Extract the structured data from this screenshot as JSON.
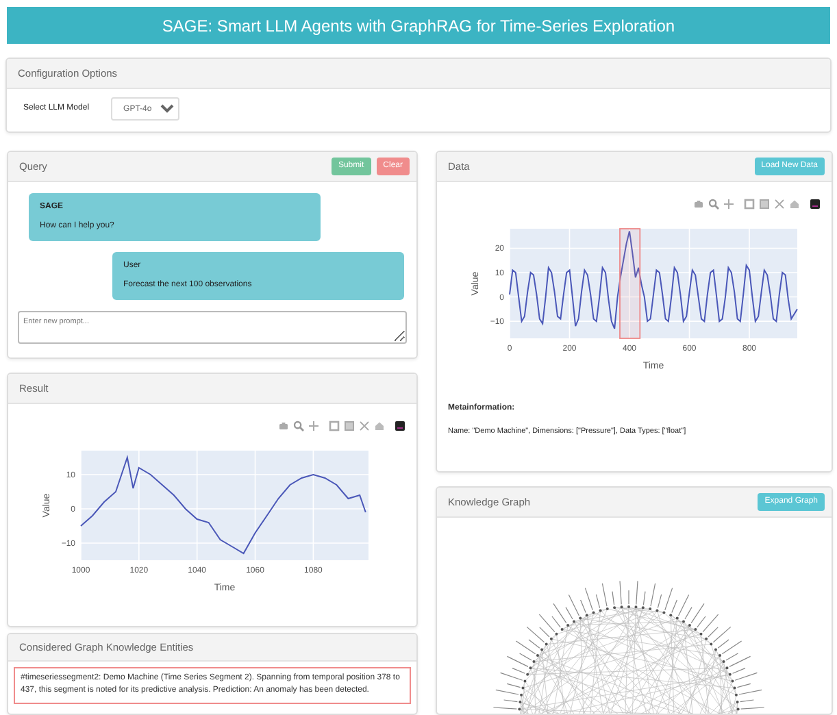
{
  "header": {
    "title": "SAGE: Smart LLM Agents with GraphRAG for Time-Series Exploration"
  },
  "config": {
    "title": "Configuration Options",
    "model_label": "Select LLM Model",
    "model": "GPT-4o"
  },
  "query": {
    "title": "Query",
    "buttons": [
      {
        "label": "Submit",
        "kind": "success"
      },
      {
        "label": "Clear",
        "kind": "danger"
      }
    ],
    "messages": [
      {
        "kind": "agent",
        "sender": "SAGE",
        "text": "How can I help you?"
      },
      {
        "kind": "user",
        "sender": "User",
        "text": "Forecast the next 100 observations"
      }
    ],
    "prompt": {
      "placeholder": "Enter new prompt..."
    }
  },
  "result": {
    "title": "Result",
    "chart_data": {
      "type": "line",
      "xlabel": "Time",
      "ylabel": "Value",
      "x": [
        1000,
        1004,
        1008,
        1012,
        1016,
        1018,
        1020,
        1024,
        1028,
        1032,
        1036,
        1040,
        1044,
        1048,
        1052,
        1056,
        1060,
        1064,
        1068,
        1072,
        1076,
        1080,
        1084,
        1088,
        1092,
        1096,
        1098
      ],
      "series": [
        {
          "color": "#4a57b8",
          "values": [
            -5,
            -2,
            2,
            5,
            15,
            6,
            12,
            10,
            7,
            4,
            0,
            -3,
            -4,
            -9,
            -11,
            -13,
            -7,
            -2,
            3,
            7,
            9,
            10,
            9,
            7,
            3,
            4,
            -1
          ]
        }
      ],
      "xlim": [
        1000,
        1099
      ],
      "ylim": [
        -15,
        17
      ],
      "grid": true,
      "xticks": [
        1000,
        1020,
        1040,
        1060,
        1080
      ],
      "yticks": [
        10,
        0,
        {
          "value": -10,
          "label": "−10"
        }
      ]
    }
  },
  "entities": {
    "title": "Considered Graph Knowledge Entities",
    "items": [
      "#timeseriessegment2: Demo Machine (Time Series Segment 2). Spanning from temporal position 378 to 437, this segment is noted for its predictive analysis. Prediction: An anomaly has been detected."
    ]
  },
  "data": {
    "title": "Data",
    "button": "Load New Data",
    "chart_data": {
      "type": "line",
      "xlabel": "Time",
      "ylabel": "Value",
      "x": [
        0,
        10,
        20,
        30,
        40,
        50,
        60,
        70,
        80,
        90,
        100,
        110,
        120,
        130,
        140,
        150,
        160,
        170,
        180,
        190,
        200,
        210,
        220,
        230,
        240,
        250,
        260,
        270,
        280,
        290,
        300,
        310,
        320,
        330,
        340,
        350,
        360,
        370,
        380,
        390,
        400,
        410,
        420,
        430,
        440,
        450,
        460,
        470,
        480,
        490,
        500,
        510,
        520,
        530,
        540,
        550,
        560,
        570,
        580,
        590,
        600,
        610,
        620,
        630,
        640,
        650,
        660,
        670,
        680,
        690,
        700,
        710,
        720,
        730,
        740,
        750,
        760,
        770,
        780,
        790,
        800,
        810,
        820,
        830,
        840,
        850,
        860,
        870,
        880,
        890,
        900,
        910,
        920,
        930,
        940,
        950,
        960
      ],
      "series": [
        {
          "color": "#4a57b8",
          "values": [
            1,
            11,
            10,
            0,
            -10,
            -8,
            2,
            10,
            9,
            1,
            -9,
            -11,
            0,
            12,
            10,
            2,
            -8,
            -9,
            1,
            10,
            11,
            0,
            -12,
            -9,
            2,
            11,
            9,
            1,
            -9,
            -10,
            0,
            12,
            10,
            -1,
            -10,
            -13,
            0,
            8,
            15,
            22,
            27,
            18,
            8,
            12,
            5,
            0,
            -10,
            -9,
            1,
            11,
            10,
            1,
            -9,
            -10,
            0,
            12,
            10,
            1,
            -10,
            -8,
            2,
            11,
            9,
            0,
            -9,
            -10,
            1,
            10,
            11,
            1,
            -10,
            -9,
            0,
            12,
            10,
            2,
            -9,
            -10,
            1,
            13,
            11,
            0,
            -10,
            -8,
            2,
            11,
            9,
            1,
            -9,
            -10,
            1,
            10,
            9,
            -1,
            -9,
            -7,
            -5
          ]
        }
      ],
      "xlim": [
        0,
        960
      ],
      "ylim": [
        -17,
        28
      ],
      "grid": true,
      "xticks": [
        0,
        200,
        400,
        600,
        800
      ],
      "yticks": [
        20,
        10,
        0,
        {
          "value": -10,
          "label": "−10"
        }
      ],
      "bands": [
        {
          "axis": "x",
          "from": 368,
          "to": 435,
          "color": "#ee8888"
        }
      ]
    },
    "meta_title": "Metainformation:",
    "meta_text": "Name: \"Demo Machine\", Dimensions: [\"Pressure\"], Data Types: [\"float\"]"
  },
  "graph": {
    "title": "Knowledge Graph",
    "button": "Expand Graph"
  }
}
